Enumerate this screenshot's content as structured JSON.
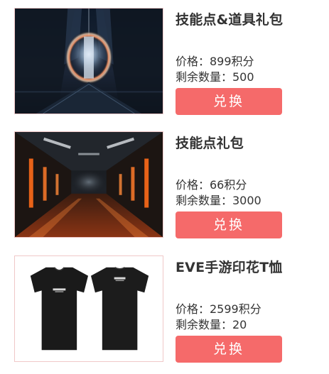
{
  "items": [
    {
      "title": "技能点&道具礼包",
      "price": "价格：899积分",
      "stock": "剩余数量：500",
      "button": "兑换",
      "image": "sci-fi-portal-art"
    },
    {
      "title": "技能点礼包",
      "price": "价格：66积分",
      "stock": "剩余数量：3000",
      "button": "兑换",
      "image": "spaceship-corridor-art"
    },
    {
      "title": "EVE手游印花T恤",
      "price": "价格：2599积分",
      "stock": "剩余数量：20",
      "button": "兑换",
      "image": "black-tshirt-photo"
    }
  ],
  "colors": {
    "button_bg": "#f56a6a",
    "button_text": "#ffffff",
    "text": "#333333"
  }
}
